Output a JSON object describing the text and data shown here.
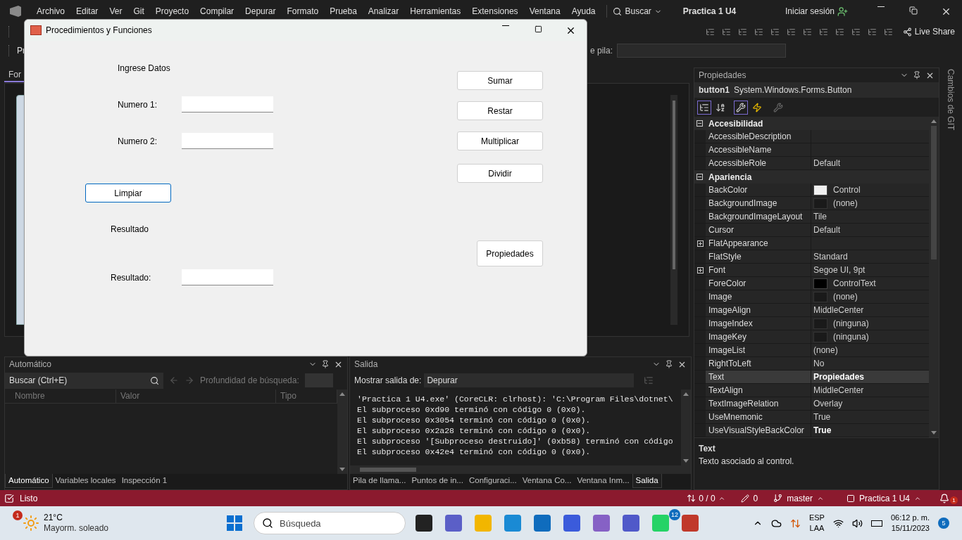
{
  "vs": {
    "menu": [
      "Archivo",
      "Editar",
      "Ver",
      "Git",
      "Proyecto",
      "Compilar",
      "Depurar",
      "Formato",
      "Prueba",
      "Analizar",
      "Herramientas",
      "Extensiones",
      "Ventana",
      "Ayuda"
    ],
    "search": "Buscar",
    "solution": "Practica 1 U4",
    "sign_in": "Iniciar sesión",
    "live_share": "Live Share",
    "toolbar_left": "Pr",
    "toolbar_right": "e pila:",
    "designer_tab": "For"
  },
  "form_window": {
    "title": "Procedimientos y Funciones",
    "heading": "Ingrese Datos",
    "inputs": [
      {
        "label": "Numero 1:"
      },
      {
        "label": "Numero 2:"
      }
    ],
    "clear_button": {
      "label": "Limpiar",
      "focused": true
    },
    "result_heading": "Resultado",
    "result": {
      "label": "Resultado:"
    },
    "buttons": [
      {
        "label": "Sumar",
        "focused": false
      },
      {
        "label": "Restar",
        "focused": false
      },
      {
        "label": "Multiplicar",
        "focused": false
      },
      {
        "label": "Dividir",
        "focused": false
      }
    ],
    "properties_button": {
      "label": "Propiedades",
      "focused": false
    }
  },
  "autos": {
    "title": "Automático",
    "search_placeholder": "Buscar (Ctrl+E)",
    "depth_label": "Profundidad de búsqueda:",
    "columns": [
      "Nombre",
      "Valor",
      "Tipo"
    ],
    "tabs": [
      {
        "label": "Automático",
        "selected": true
      },
      {
        "label": "Variables locales",
        "selected": false
      },
      {
        "label": "Inspección 1",
        "selected": false
      }
    ]
  },
  "output": {
    "title": "Salida",
    "source_label": "Mostrar salida de:",
    "source": "Depurar",
    "lines": [
      "'Practica 1 U4.exe' (CoreCLR: clrhost): 'C:\\Program Files\\dotnet\\",
      "El subproceso 0xd90 terminó con código 0 (0x0).",
      "El subproceso 0x3054 terminó con código 0 (0x0).",
      "El subproceso 0x2a28 terminó con código 0 (0x0).",
      "El subproceso '[Subproceso destruido]' (0xb58) terminó con código",
      "El subproceso 0x42e4 terminó con código 0 (0x0)."
    ],
    "tabs": [
      {
        "label": "Pila de llama...",
        "selected": false
      },
      {
        "label": "Puntos de in...",
        "selected": false
      },
      {
        "label": "Configuraci...",
        "selected": false
      },
      {
        "label": "Ventana Co...",
        "selected": false
      },
      {
        "label": "Ventana Inm...",
        "selected": false
      },
      {
        "label": "Salida",
        "selected": true
      }
    ]
  },
  "properties": {
    "title": "Propiedades",
    "object": "button1",
    "object_type": "System.Windows.Forms.Button",
    "categories": [
      {
        "name": "Accesibilidad",
        "expanded": true,
        "rows": [
          {
            "name": "AccessibleDescription",
            "value": "",
            "kind": "plain",
            "selected": false
          },
          {
            "name": "AccessibleName",
            "value": "",
            "kind": "plain",
            "selected": false
          },
          {
            "name": "AccessibleRole",
            "value": "Default",
            "kind": "plain",
            "modified": false,
            "selected": false
          }
        ]
      },
      {
        "name": "Apariencia",
        "expanded": true,
        "rows": [
          {
            "name": "BackColor",
            "value": "Control",
            "kind": "swatch",
            "color": "#f0f0f0",
            "modified": false,
            "selected": false
          },
          {
            "name": "BackgroundImage",
            "value": "(none)",
            "kind": "empty_swatch",
            "modified": false,
            "selected": false
          },
          {
            "name": "BackgroundImageLayout",
            "value": "Tile",
            "kind": "plain",
            "modified": false,
            "selected": false
          },
          {
            "name": "Cursor",
            "value": "Default",
            "kind": "plain",
            "modified": false,
            "selected": false
          },
          {
            "name": "FlatAppearance",
            "value": "",
            "kind": "group",
            "selected": false
          },
          {
            "name": "FlatStyle",
            "value": "Standard",
            "kind": "plain",
            "modified": false,
            "selected": false
          },
          {
            "name": "Font",
            "value": "Segoe UI, 9pt",
            "kind": "group",
            "modified": false,
            "selected": false
          },
          {
            "name": "ForeColor",
            "value": "ControlText",
            "kind": "swatch",
            "color": "#000000",
            "modified": false,
            "selected": false
          },
          {
            "name": "Image",
            "value": "(none)",
            "kind": "empty_swatch",
            "modified": false,
            "selected": false
          },
          {
            "name": "ImageAlign",
            "value": "MiddleCenter",
            "kind": "plain",
            "modified": false,
            "selected": false
          },
          {
            "name": "ImageIndex",
            "value": "(ninguna)",
            "kind": "empty_swatch",
            "modified": false,
            "selected": false
          },
          {
            "name": "ImageKey",
            "value": "(ninguna)",
            "kind": "empty_swatch",
            "modified": false,
            "selected": false
          },
          {
            "name": "ImageList",
            "value": "(none)",
            "kind": "plain",
            "modified": false,
            "selected": false
          },
          {
            "name": "RightToLeft",
            "value": "No",
            "kind": "plain",
            "modified": false,
            "selected": false
          },
          {
            "name": "Text",
            "value": "Propiedades",
            "kind": "plain",
            "modified": true,
            "selected": true
          },
          {
            "name": "TextAlign",
            "value": "MiddleCenter",
            "kind": "plain",
            "modified": false,
            "selected": false
          },
          {
            "name": "TextImageRelation",
            "value": "Overlay",
            "kind": "plain",
            "modified": false,
            "selected": false
          },
          {
            "name": "UseMnemonic",
            "value": "True",
            "kind": "plain",
            "modified": false,
            "selected": false
          },
          {
            "name": "UseVisualStyleBackColor",
            "value": "True",
            "kind": "plain",
            "modified": true,
            "selected": false
          }
        ]
      }
    ],
    "description_title": "Text",
    "description": "Texto asociado al control."
  },
  "git_tab": "Cambios de GIT",
  "status_bar": {
    "state": "Listo",
    "changes": "0 / 0",
    "pending": "0",
    "branch": "master",
    "repo": "Practica 1 U4",
    "notifications": "1"
  },
  "taskbar": {
    "weather_badge": "1",
    "temperature": "21°C",
    "weather": "Mayorm. soleado",
    "search_placeholder": "Búsqueda",
    "chat_badge": "12",
    "language": "ESP",
    "layout": "LAA",
    "time": "06:12 p. m.",
    "date": "15/11/2023",
    "notification_count": "5"
  }
}
